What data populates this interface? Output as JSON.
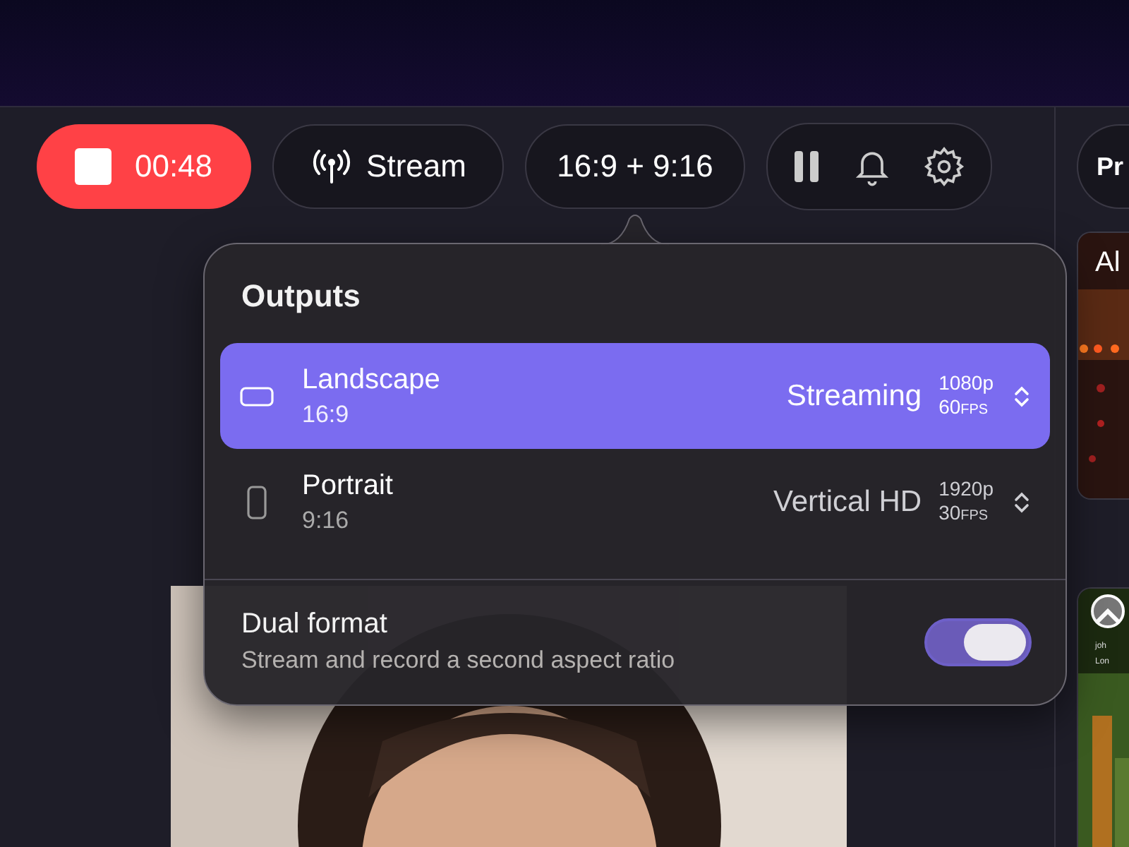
{
  "recording": {
    "time": "00:48",
    "on": true
  },
  "toolbar": {
    "stream_label": "Stream",
    "format_label": "16:9 + 9:16",
    "side_label": "Pr"
  },
  "outputs": {
    "title": "Outputs",
    "items": [
      {
        "kind": "landscape",
        "name": "Landscape",
        "ratio": "16:9",
        "preset": "Streaming",
        "resolution": "1080p",
        "fps": "60",
        "fps_unit": "FPS",
        "selected": true
      },
      {
        "kind": "portrait",
        "name": "Portrait",
        "ratio": "9:16",
        "preset": "Vertical HD",
        "resolution": "1920p",
        "fps": "30",
        "fps_unit": "FPS",
        "selected": false
      }
    ]
  },
  "dual_format": {
    "title": "Dual format",
    "description": "Stream and record a second aspect ratio",
    "on": true
  },
  "side_cards": [
    {
      "title": "Al"
    },
    {
      "lines": [
        "joh",
        "Lon"
      ]
    }
  ]
}
